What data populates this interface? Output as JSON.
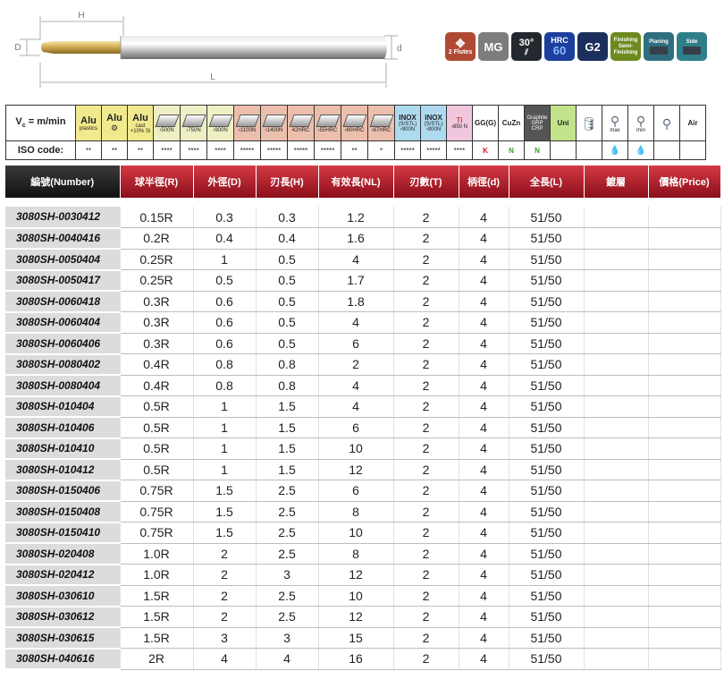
{
  "drawing": {
    "label_h": "H",
    "label_d_shank": "D",
    "label_d": "d",
    "label_l": "L"
  },
  "badges": [
    {
      "id": "flutes",
      "text": "2 Flutes",
      "icon": "flute-icon"
    },
    {
      "id": "mg",
      "text": "MG"
    },
    {
      "id": "angle",
      "text": "30°",
      "icon": "helix-angle-icon"
    },
    {
      "id": "hrc",
      "text": "HRC",
      "value": "60"
    },
    {
      "id": "g2",
      "text": "G2"
    },
    {
      "id": "finishing",
      "text": "Finishing",
      "text2": "Semi-Finishing"
    },
    {
      "id": "planing",
      "text": "Planing",
      "icon": "block-icon"
    },
    {
      "id": "side",
      "text": "Side",
      "icon": "block-icon"
    }
  ],
  "materials": {
    "vc_label": "V",
    "vc_sub": "c",
    "vc_suffix": " = m/min",
    "iso_label": "ISO code:",
    "columns": [
      {
        "title": "Alu",
        "sub": "plastics",
        "iso": "**"
      },
      {
        "title": "Alu",
        "sub": "",
        "iso": "**"
      },
      {
        "title": "Alu",
        "sub": "cast",
        "sub2": "+10% Si",
        "iso": "**"
      },
      {
        "title": "",
        "sub": "‹500N",
        "iso": "****"
      },
      {
        "title": "",
        "sub": "‹750N",
        "iso": "****"
      },
      {
        "title": "",
        "sub": "‹900N",
        "iso": "****"
      },
      {
        "title": "",
        "sub": "‹1100N",
        "iso": "*****"
      },
      {
        "title": "",
        "sub": "‹1400N",
        "iso": "*****"
      },
      {
        "title": "",
        "sub": "42HRC",
        "iso": "*****"
      },
      {
        "title": "",
        "sub": "‹55HRC",
        "iso": "*****"
      },
      {
        "title": "",
        "sub": "‹60HRC",
        "iso": "**"
      },
      {
        "title": "",
        "sub": "‹67HRC",
        "iso": "*"
      },
      {
        "title": "INOX",
        "sub": "(S/STL)",
        "sub2": "‹900N",
        "iso": "*****"
      },
      {
        "title": "INOX",
        "sub": "(S/STL)",
        "sub2": "›900N",
        "iso": "*****"
      },
      {
        "title": "Ti",
        "sub": "›850 N",
        "iso": "****"
      },
      {
        "title": "GG(G)",
        "sub": "",
        "iso": "K"
      },
      {
        "title": "CuZn",
        "sub": "",
        "iso": "N"
      },
      {
        "title": "Graphite",
        "sub": "GRP",
        "sub2": "CRP",
        "iso": "N"
      },
      {
        "title": "Uni",
        "sub": "",
        "iso": ""
      },
      {
        "title": "",
        "sub": "",
        "iso": ""
      },
      {
        "title": "",
        "sub": "max",
        "iso": "drop"
      },
      {
        "title": "",
        "sub": "min",
        "iso": "drop"
      },
      {
        "title": "",
        "sub": "",
        "iso": ""
      },
      {
        "title": "Air",
        "sub": "",
        "iso": ""
      }
    ]
  },
  "table": {
    "headers": [
      "編號(Number)",
      "球半徑(R)",
      "外徑(D)",
      "刃長(H)",
      "有效長(NL)",
      "刃數(T)",
      "柄徑(d)",
      "全長(L)",
      "鍍層",
      "價格(Price)"
    ],
    "rows": [
      [
        "3080SH-0030412",
        "0.15R",
        "0.3",
        "0.3",
        "1.2",
        "2",
        "4",
        "51/50",
        "",
        ""
      ],
      [
        "3080SH-0040416",
        "0.2R",
        "0.4",
        "0.4",
        "1.6",
        "2",
        "4",
        "51/50",
        "",
        ""
      ],
      [
        "3080SH-0050404",
        "0.25R",
        "1",
        "0.5",
        "4",
        "2",
        "4",
        "51/50",
        "",
        ""
      ],
      [
        "3080SH-0050417",
        "0.25R",
        "0.5",
        "0.5",
        "1.7",
        "2",
        "4",
        "51/50",
        "",
        ""
      ],
      [
        "3080SH-0060418",
        "0.3R",
        "0.6",
        "0.5",
        "1.8",
        "2",
        "4",
        "51/50",
        "",
        ""
      ],
      [
        "3080SH-0060404",
        "0.3R",
        "0.6",
        "0.5",
        "4",
        "2",
        "4",
        "51/50",
        "",
        ""
      ],
      [
        "3080SH-0060406",
        "0.3R",
        "0.6",
        "0.5",
        "6",
        "2",
        "4",
        "51/50",
        "",
        ""
      ],
      [
        "3080SH-0080402",
        "0.4R",
        "0.8",
        "0.8",
        "2",
        "2",
        "4",
        "51/50",
        "",
        ""
      ],
      [
        "3080SH-0080404",
        "0.4R",
        "0.8",
        "0.8",
        "4",
        "2",
        "4",
        "51/50",
        "",
        ""
      ],
      [
        "3080SH-010404",
        "0.5R",
        "1",
        "1.5",
        "4",
        "2",
        "4",
        "51/50",
        "",
        ""
      ],
      [
        "3080SH-010406",
        "0.5R",
        "1",
        "1.5",
        "6",
        "2",
        "4",
        "51/50",
        "",
        ""
      ],
      [
        "3080SH-010410",
        "0.5R",
        "1",
        "1.5",
        "10",
        "2",
        "4",
        "51/50",
        "",
        ""
      ],
      [
        "3080SH-010412",
        "0.5R",
        "1",
        "1.5",
        "12",
        "2",
        "4",
        "51/50",
        "",
        ""
      ],
      [
        "3080SH-0150406",
        "0.75R",
        "1.5",
        "2.5",
        "6",
        "2",
        "4",
        "51/50",
        "",
        ""
      ],
      [
        "3080SH-0150408",
        "0.75R",
        "1.5",
        "2.5",
        "8",
        "2",
        "4",
        "51/50",
        "",
        ""
      ],
      [
        "3080SH-0150410",
        "0.75R",
        "1.5",
        "2.5",
        "10",
        "2",
        "4",
        "51/50",
        "",
        ""
      ],
      [
        "3080SH-020408",
        "1.0R",
        "2",
        "2.5",
        "8",
        "2",
        "4",
        "51/50",
        "",
        ""
      ],
      [
        "3080SH-020412",
        "1.0R",
        "2",
        "3",
        "12",
        "2",
        "4",
        "51/50",
        "",
        ""
      ],
      [
        "3080SH-030610",
        "1.5R",
        "2",
        "2.5",
        "10",
        "2",
        "4",
        "51/50",
        "",
        ""
      ],
      [
        "3080SH-030612",
        "1.5R",
        "2",
        "2.5",
        "12",
        "2",
        "4",
        "51/50",
        "",
        ""
      ],
      [
        "3080SH-030615",
        "1.5R",
        "3",
        "3",
        "15",
        "2",
        "4",
        "51/50",
        "",
        ""
      ],
      [
        "3080SH-040616",
        "2R",
        "4",
        "4",
        "16",
        "2",
        "4",
        "51/50",
        "",
        ""
      ]
    ]
  }
}
